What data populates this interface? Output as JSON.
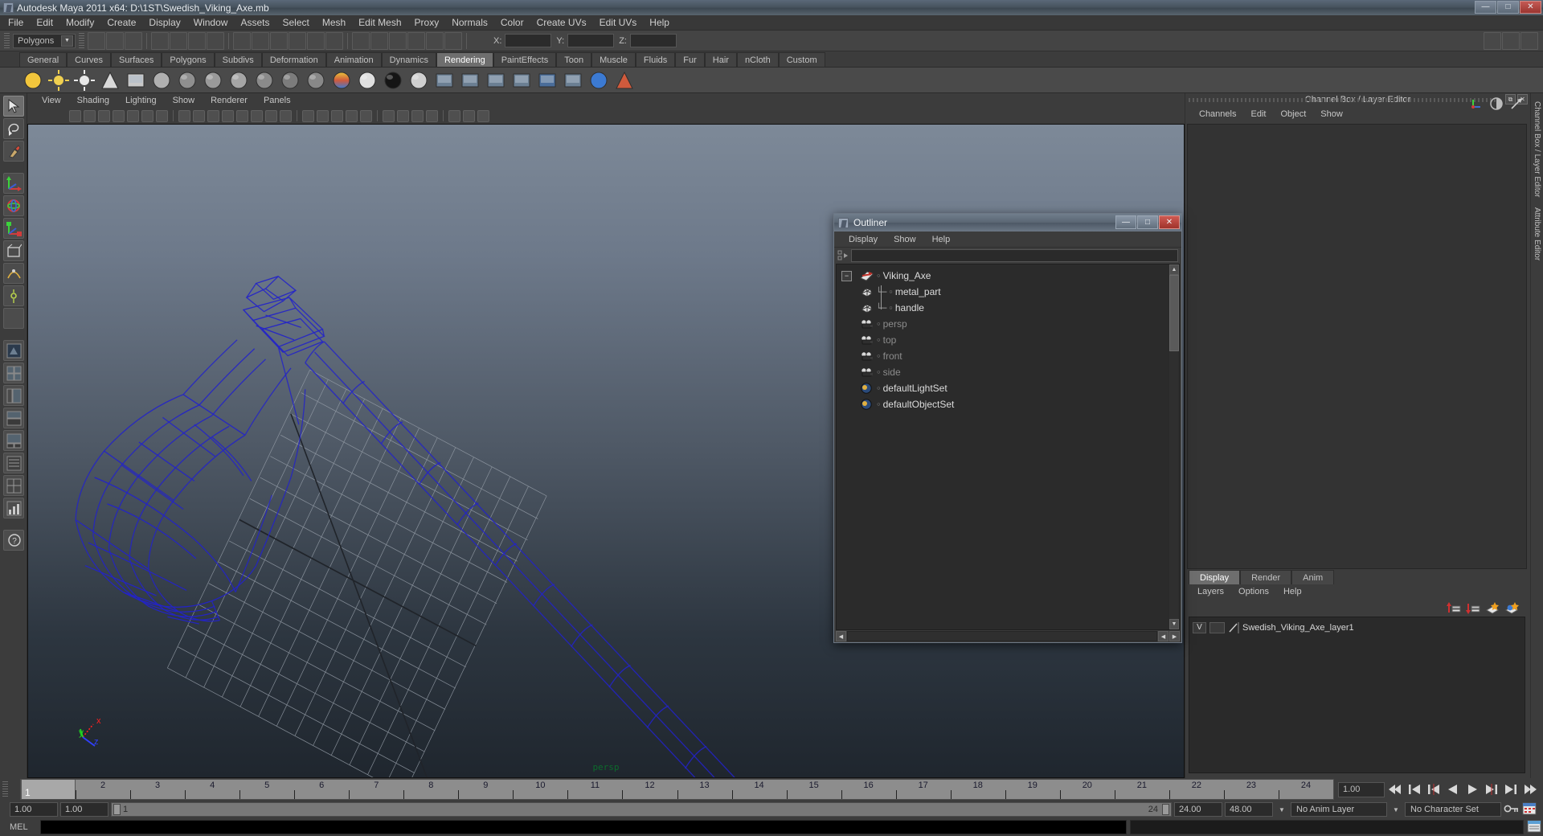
{
  "window": {
    "title": "Autodesk Maya 2011 x64: D:\\1ST\\Swedish_Viking_Axe.mb",
    "app_icon": "maya-icon",
    "buttons": {
      "minimize": "—",
      "maximize": "□",
      "close": "✕"
    }
  },
  "menubar": {
    "items": [
      "File",
      "Edit",
      "Modify",
      "Create",
      "Display",
      "Window",
      "Assets",
      "Select",
      "Mesh",
      "Edit Mesh",
      "Proxy",
      "Normals",
      "Color",
      "Create UVs",
      "Edit UVs",
      "Help"
    ]
  },
  "statusbar": {
    "mode_select": {
      "value": "Polygons"
    },
    "coords": {
      "x_label": "X:",
      "y_label": "Y:",
      "z_label": "Z:",
      "x_value": "",
      "y_value": "",
      "z_value": ""
    }
  },
  "shelf": {
    "tabs": [
      "General",
      "Curves",
      "Surfaces",
      "Polygons",
      "Subdivs",
      "Deformation",
      "Animation",
      "Dynamics",
      "Rendering",
      "PaintEffects",
      "Toon",
      "Muscle",
      "Fluids",
      "Fur",
      "Hair",
      "nCloth",
      "Custom"
    ],
    "active_tab": "Rendering"
  },
  "viewport": {
    "menus": [
      "View",
      "Shading",
      "Lighting",
      "Show",
      "Renderer",
      "Panels"
    ],
    "camera_label": "persp",
    "axis": {
      "x": "x",
      "y": "y",
      "z": "z",
      "x_color": "#ff2020",
      "y_color": "#20d820",
      "z_color": "#3040ff"
    },
    "wireframe_color": "#2323c8",
    "grid_color": "#9aa3ad"
  },
  "outliner": {
    "title": "Outliner",
    "icon": "maya-icon",
    "buttons": {
      "minimize": "—",
      "maximize": "□",
      "close": "✕"
    },
    "menus": [
      "Display",
      "Show",
      "Help"
    ],
    "search_value": "",
    "items": [
      {
        "label": "Viking_Axe",
        "icon": "transform-icon",
        "depth": 0,
        "expander": "−",
        "connector": "",
        "dim": false
      },
      {
        "label": "metal_part",
        "icon": "mesh-icon",
        "depth": 1,
        "expander": "",
        "connector": "└─",
        "dim": false
      },
      {
        "label": "handle",
        "icon": "mesh-icon",
        "depth": 1,
        "expander": "",
        "connector": "└─",
        "dim": false
      },
      {
        "label": "persp",
        "icon": "camera-icon",
        "depth": 1,
        "expander": "",
        "connector": "",
        "dim": true
      },
      {
        "label": "top",
        "icon": "camera-icon",
        "depth": 1,
        "expander": "",
        "connector": "",
        "dim": true
      },
      {
        "label": "front",
        "icon": "camera-icon",
        "depth": 1,
        "expander": "",
        "connector": "",
        "dim": true
      },
      {
        "label": "side",
        "icon": "camera-icon",
        "depth": 1,
        "expander": "",
        "connector": "",
        "dim": true
      },
      {
        "label": "defaultLightSet",
        "icon": "set-icon",
        "depth": 1,
        "expander": "",
        "connector": "",
        "dim": false
      },
      {
        "label": "defaultObjectSet",
        "icon": "set-icon",
        "depth": 1,
        "expander": "",
        "connector": "",
        "dim": false
      }
    ]
  },
  "channelbox": {
    "panel_title": "Channel Box / Layer Editor",
    "menus": [
      "Channels",
      "Edit",
      "Object",
      "Show"
    ],
    "buttons": {
      "float": "⧉",
      "close": "✕"
    },
    "side_tabs": [
      "Channel Box / Layer Editor",
      "Attribute Editor"
    ]
  },
  "layer_editor": {
    "tabs": [
      "Display",
      "Render",
      "Anim"
    ],
    "active_tab": "Display",
    "menus": [
      "Layers",
      "Options",
      "Help"
    ],
    "toolbar_icons": [
      "layer-move-up-icon",
      "layer-move-down-icon",
      "create-empty-layer-icon",
      "create-layer-from-selection-icon"
    ],
    "layers": [
      {
        "visibility": "V",
        "display_type": "",
        "name": "Swedish_Viking_Axe_layer1"
      }
    ]
  },
  "timeline": {
    "frames": [
      "1",
      "2",
      "3",
      "4",
      "5",
      "6",
      "7",
      "8",
      "9",
      "10",
      "11",
      "12",
      "13",
      "14",
      "15",
      "16",
      "17",
      "18",
      "19",
      "20",
      "21",
      "22",
      "23",
      "24"
    ],
    "current_frame": "1",
    "current_frame_field": "1.00",
    "playback_buttons": [
      "go-to-start-icon",
      "step-back-key-icon",
      "step-back-frame-icon",
      "play-backwards-icon",
      "play-forwards-icon",
      "step-forward-frame-icon",
      "step-forward-key-icon",
      "go-to-end-icon"
    ]
  },
  "rangebar": {
    "anim_start": "1.00",
    "anim_end": "1.00",
    "range_start": "1",
    "range_end": "24",
    "playback_end": "24.00",
    "anim_end_total": "48.00",
    "anim_layer": "No Anim Layer",
    "character_set": "No Character Set",
    "right_icons": [
      "auto-key-icon",
      "animation-preferences-icon"
    ]
  },
  "commandline": {
    "label": "MEL",
    "input_value": "",
    "output_value": "",
    "icon": "script-editor-icon"
  }
}
